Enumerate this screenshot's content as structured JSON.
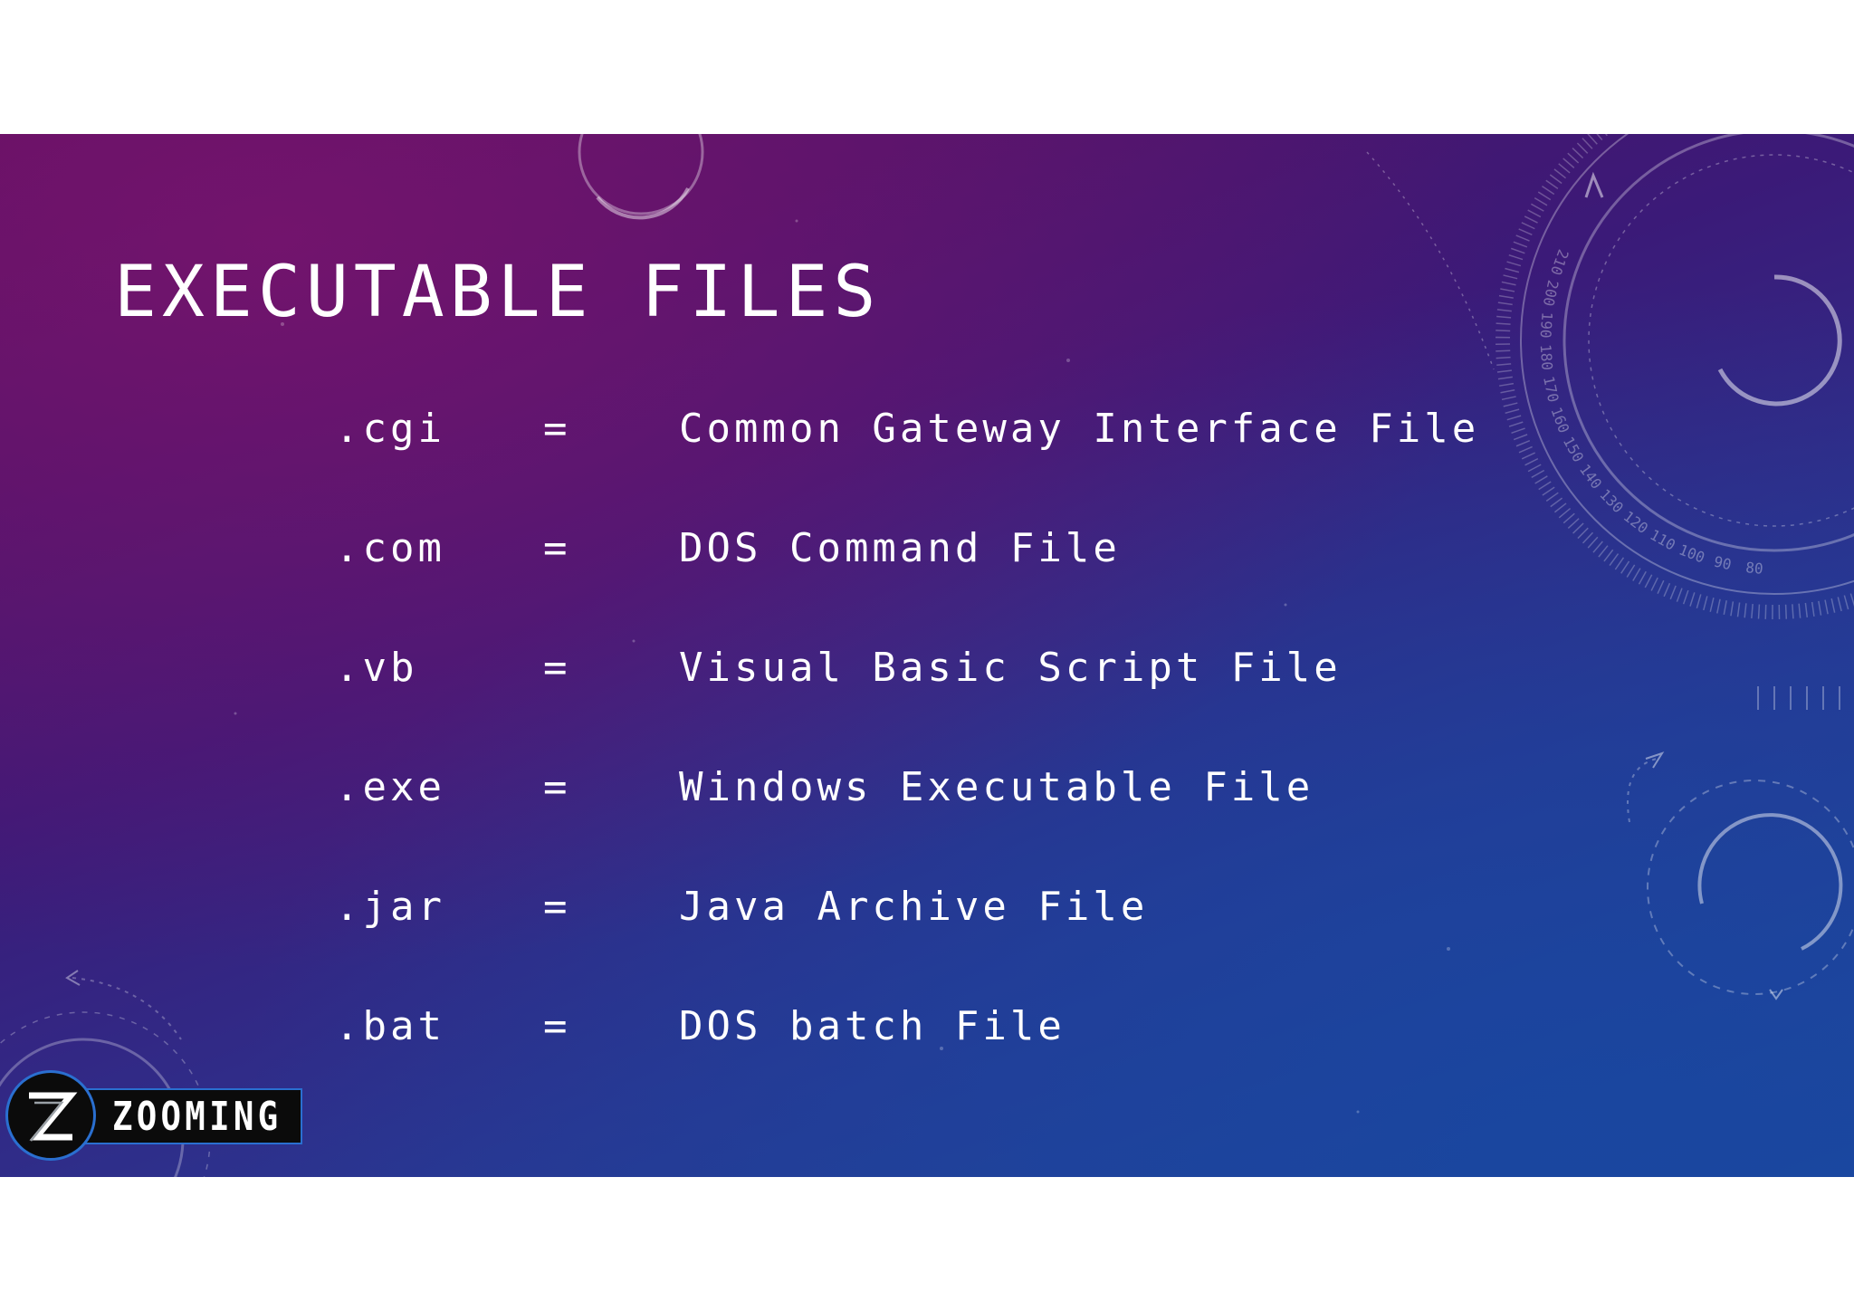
{
  "slide": {
    "title": "EXECUTABLE FILES",
    "rows": [
      {
        "ext": ".cgi",
        "sep": "=",
        "desc": "Common Gateway Interface File"
      },
      {
        "ext": ".com",
        "sep": "=",
        "desc": "DOS Command File"
      },
      {
        "ext": ".vb",
        "sep": "=",
        "desc": "Visual Basic Script File"
      },
      {
        "ext": ".exe",
        "sep": "=",
        "desc": "Windows Executable File"
      },
      {
        "ext": ".jar",
        "sep": "=",
        "desc": "Java Archive File"
      },
      {
        "ext": ".bat",
        "sep": "=",
        "desc": "DOS batch File"
      }
    ]
  },
  "logo": {
    "name": "ZOOMING",
    "icon": "z-letter-icon"
  },
  "decor": {
    "dial_numbers": [
      "80",
      "90",
      "100",
      "110",
      "120",
      "130",
      "140",
      "150",
      "160",
      "170",
      "180",
      "190",
      "200",
      "210"
    ]
  },
  "colors": {
    "background_top": "#5a0f5e",
    "background_bottom": "#1d4a9e",
    "text": "#ffffff",
    "logo_accent": "#2a6fd0"
  }
}
